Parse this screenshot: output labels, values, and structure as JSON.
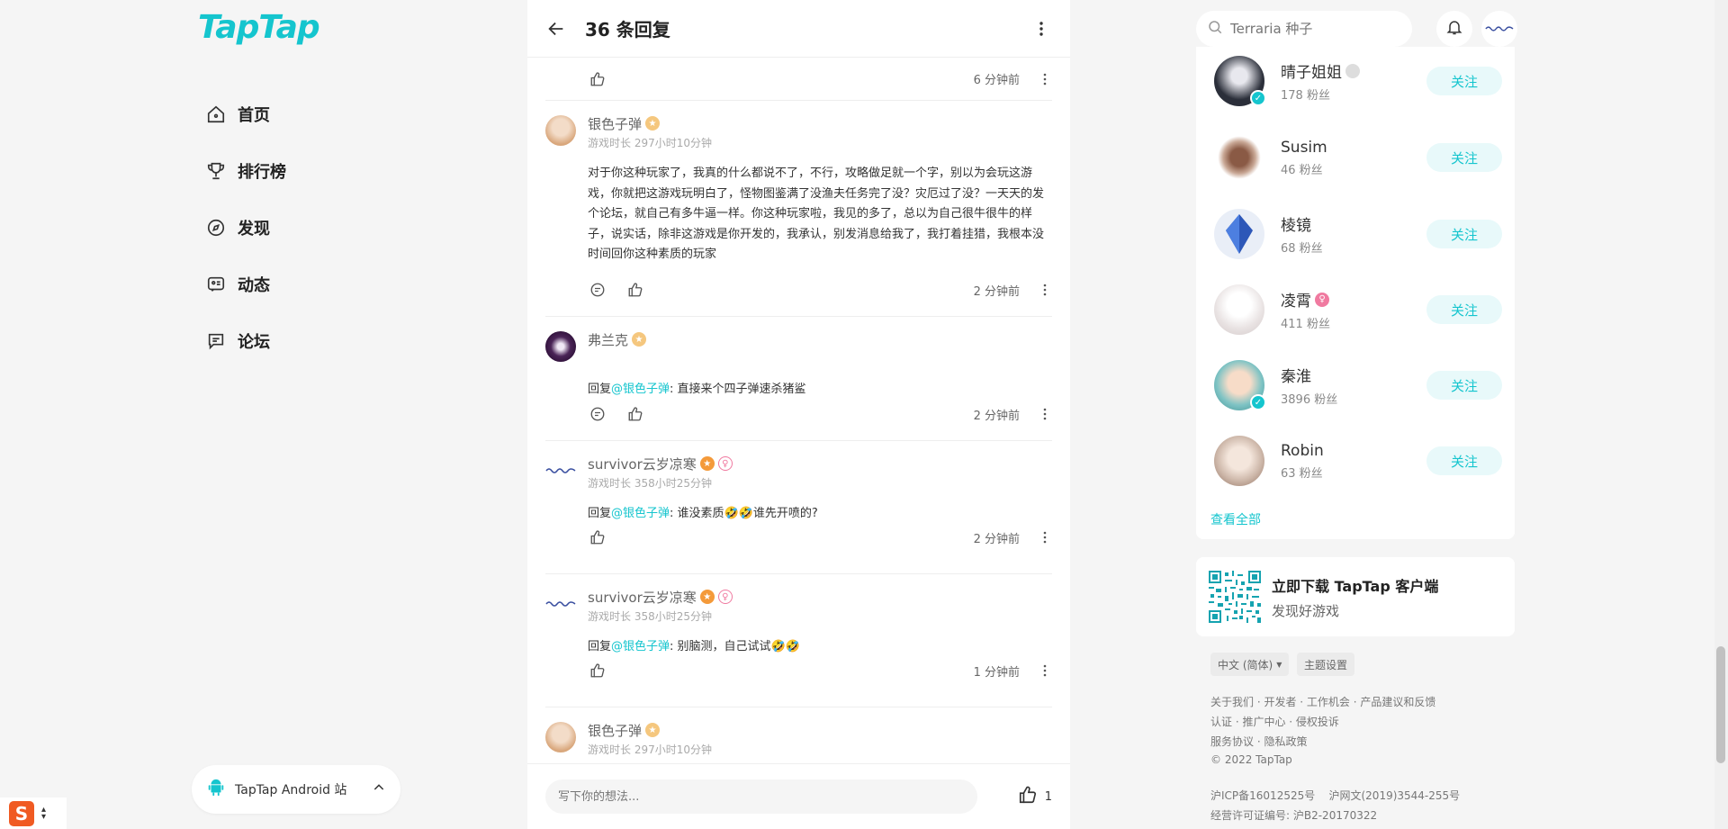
{
  "brand": {
    "logo_text": "TapTap",
    "accent": "#15c5ce"
  },
  "nav": {
    "items": [
      {
        "label": "首页",
        "icon": "home-icon"
      },
      {
        "label": "排行榜",
        "icon": "trophy-icon"
      },
      {
        "label": "发现",
        "icon": "discover-icon"
      },
      {
        "label": "动态",
        "icon": "feed-icon"
      },
      {
        "label": "论坛",
        "icon": "forum-icon"
      }
    ],
    "android_pill": "TapTap Android 站"
  },
  "thread": {
    "title": "36 条回复",
    "first_time": "6 分钟前",
    "comments": [
      {
        "name": "银色子弹",
        "meta": "游戏时长 297小时10分钟",
        "prefix": "",
        "mention": "",
        "text": "对于你这种玩家了，我真的什么都说不了，不行，攻略做足就一个字，别以为会玩这游戏，你就把这游戏玩明白了，怪物图鉴满了没渔夫任务完了没？灾厄过了没？一天天的发个论坛，就自己有多牛逼一样。你这种玩家啦，我见的多了，总以为自己很牛很牛的样子，说实话，除非这游戏是你开发的，我承认，别发消息给我了，我打着挂猎，我根本没时间回你这种素质的玩家",
        "time": "2 分钟前"
      },
      {
        "name": "弗兰克",
        "meta": "",
        "prefix": "回复",
        "mention": "@银色子弹",
        "text": ": 直接来个四子弹速杀猪鲨",
        "time": "2 分钟前"
      },
      {
        "name": "survivor云岁凉寒",
        "meta": "游戏时长 358小时25分钟",
        "prefix": "回复",
        "mention": "@银色子弹",
        "text": ": 谁没素质🤣🤣谁先开喷的?",
        "time": "2 分钟前"
      },
      {
        "name": "survivor云岁凉寒",
        "meta": "游戏时长 358小时25分钟",
        "prefix": "回复",
        "mention": "@银色子弹",
        "text": ": 别脑测，自己试试🤣🤣",
        "time": "1 分钟前"
      },
      {
        "name": "银色子弹",
        "meta": "游戏时长 297小时10分钟",
        "prefix": "",
        "mention": "",
        "text": "",
        "time": ""
      }
    ],
    "reply_placeholder": "写下你的想法...",
    "like_count": "1"
  },
  "search": {
    "placeholder": "Terraria 种子"
  },
  "recommend": {
    "items": [
      {
        "name": "晴子姐姐",
        "fans": "178 粉丝",
        "follow": "关注",
        "color": "#2b2f3a"
      },
      {
        "name": "Susim",
        "fans": "46 粉丝",
        "follow": "关注",
        "color": "#8a5a45"
      },
      {
        "name": "棱镜",
        "fans": "68 粉丝",
        "follow": "关注",
        "color": "#2d57b8"
      },
      {
        "name": "凌霄",
        "fans": "411 粉丝",
        "follow": "关注",
        "color": "#e9e3e3"
      },
      {
        "name": "秦淮",
        "fans": "3896 粉丝",
        "follow": "关注",
        "color": "#7ec3c4"
      },
      {
        "name": "Robin",
        "fans": "63 粉丝",
        "follow": "关注",
        "color": "#cdb7a9"
      }
    ],
    "see_all": "查看全部"
  },
  "download": {
    "title": "立即下载 TapTap 客户端",
    "subtitle": "发现好游戏"
  },
  "footer": {
    "language": "中文 (简体)",
    "theme": "主题设置",
    "links1": "关于我们 · 开发者 · 工作机会 · 产品建议和反馈",
    "links2": "认证 · 推广中心 · 侵权投诉",
    "links3": "服务协议 · 隐私政策",
    "copyright": "© 2022 TapTap",
    "icp": "沪ICP备16012525号    沪网文(2019)3544-255号",
    "license": "经营许可证编号: 沪B2-20170322"
  }
}
